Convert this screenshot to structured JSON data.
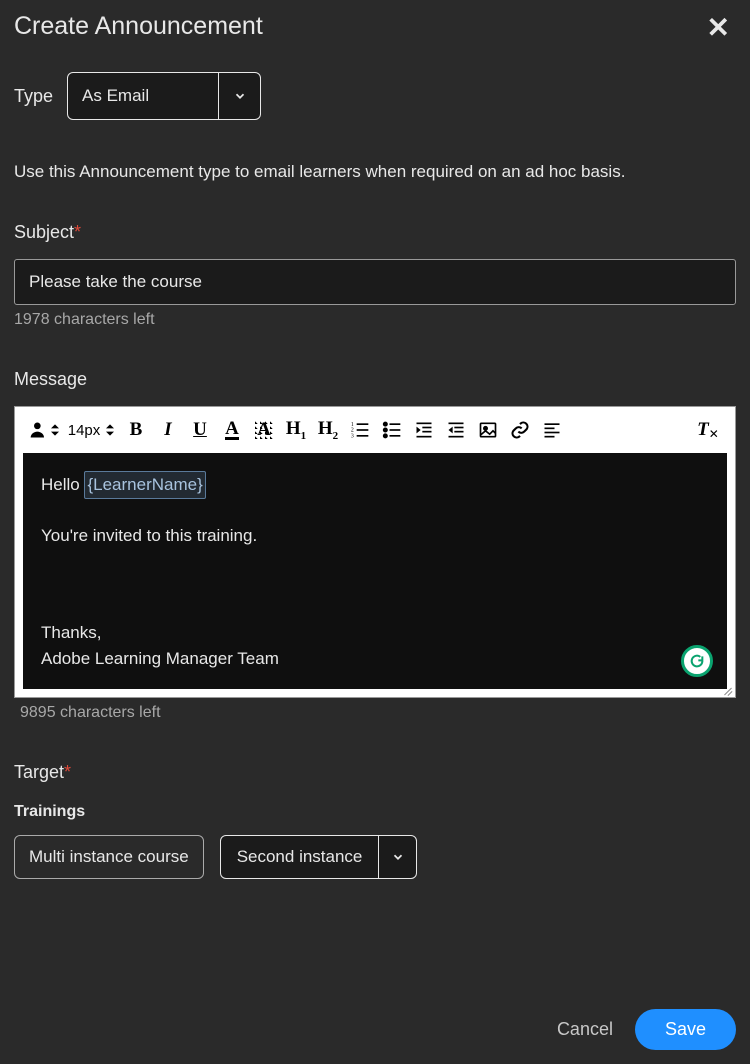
{
  "header": {
    "title": "Create Announcement"
  },
  "type": {
    "label": "Type",
    "value": "As Email"
  },
  "description": "Use this Announcement type to email learners when required on an ad hoc basis.",
  "subject": {
    "label": "Subject",
    "value": "Please take the course",
    "helper": "1978 characters left"
  },
  "message": {
    "label": "Message",
    "font_size": "14px",
    "body": {
      "greeting_prefix": "Hello ",
      "placeholder_token": "{LearnerName}",
      "line2": "You're invited to this training.",
      "signoff1": "Thanks,",
      "signoff2": "Adobe Learning Manager Team"
    },
    "helper": "9895 characters left"
  },
  "target": {
    "label": "Target",
    "trainings_label": "Trainings",
    "chips": {
      "chip1": "Multi instance course",
      "chip2": "Second instance"
    }
  },
  "actions": {
    "cancel": "Cancel",
    "save": "Save"
  }
}
